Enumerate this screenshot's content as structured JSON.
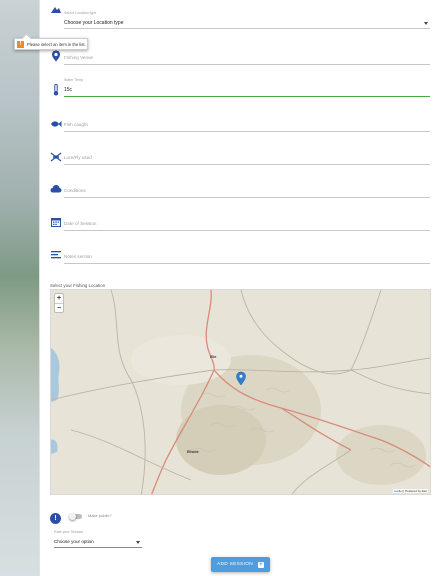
{
  "location_type": {
    "label": "Select Location type",
    "value": "Choose your Location type"
  },
  "tooltip": {
    "text": "Please select an item in the list."
  },
  "fields": {
    "venue": {
      "placeholder": "Fishing Venue"
    },
    "water_temp": {
      "label": "Water Temp",
      "value": "15c"
    },
    "fish": {
      "placeholder": "Fish caught"
    },
    "lure": {
      "placeholder": "Lure/Fly used"
    },
    "conditions": {
      "placeholder": "Conditions"
    },
    "date": {
      "placeholder": "Date of Session"
    },
    "notes": {
      "placeholder": "Notes section"
    }
  },
  "map": {
    "label": "Select your Fishing Location",
    "zoom_in": "+",
    "zoom_out": "−",
    "towns": [
      "Elie",
      "Ellside"
    ],
    "attribution_leaflet": "Leaflet",
    "attribution_rest": " | Powered by Esri"
  },
  "public": {
    "info": "!",
    "label": "Make public?"
  },
  "rate": {
    "label": "Rate your Session",
    "value": "Choose your option"
  },
  "submit": {
    "label": "ADD SESSION",
    "icon": "+"
  },
  "colors": {
    "accent": "#4d9de0",
    "active_line": "#45a845",
    "icon_blue": "#2b4fa8",
    "warn": "#f08a24"
  }
}
